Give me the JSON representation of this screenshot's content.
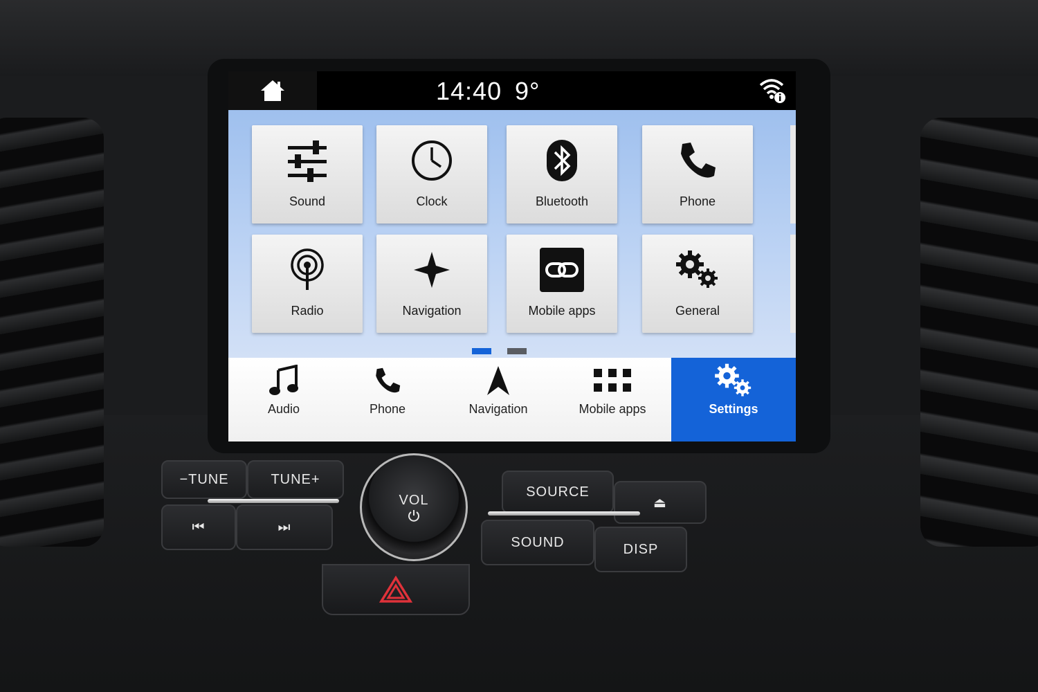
{
  "status_bar": {
    "time": "14:40",
    "temperature": "9°"
  },
  "tiles": [
    {
      "label": "Sound",
      "icon": "sliders-icon"
    },
    {
      "label": "Clock",
      "icon": "clock-icon"
    },
    {
      "label": "Bluetooth",
      "icon": "bluetooth-icon"
    },
    {
      "label": "Phone",
      "icon": "phone-icon"
    },
    {
      "label": "Radio",
      "icon": "radio-icon"
    },
    {
      "label": "Navigation",
      "icon": "compass-star-icon"
    },
    {
      "label": "Mobile apps",
      "icon": "link-icon"
    },
    {
      "label": "General",
      "icon": "gears-icon"
    }
  ],
  "pager": {
    "current_page": 1,
    "total_pages": 2
  },
  "bottom_nav": [
    {
      "label": "Audio",
      "icon": "music-note-icon"
    },
    {
      "label": "Phone",
      "icon": "phone-icon"
    },
    {
      "label": "Navigation",
      "icon": "navigation-arrow-icon"
    },
    {
      "label": "Mobile apps",
      "icon": "grid-icon"
    },
    {
      "label": "Settings",
      "icon": "gears-icon",
      "active": true
    }
  ],
  "controls": {
    "tune_down": "−TUNE",
    "tune_up": "TUNE+",
    "seek_back": "⏮",
    "seek_forward": "⏭",
    "volume": "VOL",
    "source": "SOURCE",
    "eject": "⏏",
    "sound": "SOUND",
    "display": "DISP"
  },
  "colors": {
    "accent": "#1463d8",
    "screen_bg": "#b4cdf2",
    "hazard": "#e0323a"
  }
}
